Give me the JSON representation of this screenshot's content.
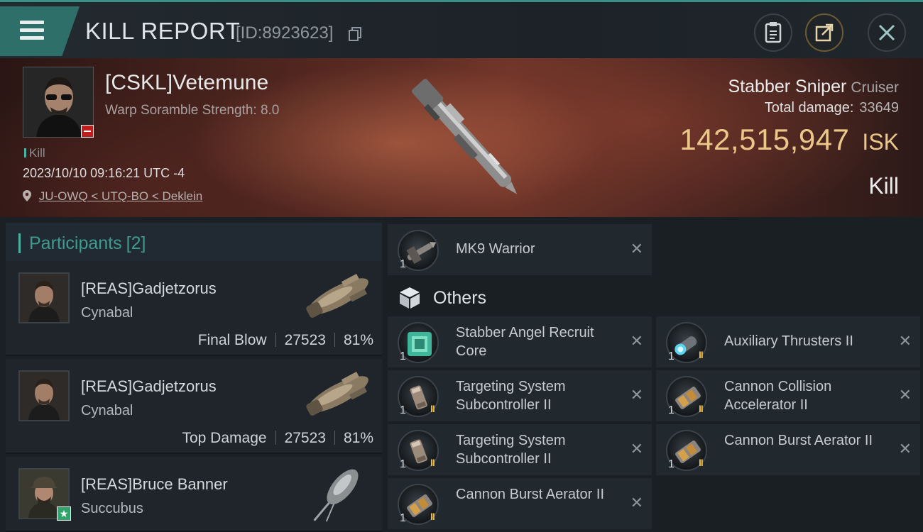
{
  "header": {
    "title": "KILL REPORT",
    "id_text": "[ID:8923623]"
  },
  "victim": {
    "name": "[CSKL]Vetemune",
    "subtitle": "Warp Soramble Strength: 8.0",
    "tag": "Kill",
    "timestamp": "2023/10/10 09:16:21 UTC -4",
    "location": "JU-OWQ < UTQ-BO < Deklein",
    "ship_name": "Stabber Sniper",
    "ship_class": "Cruiser",
    "total_damage_label": "Total damage:",
    "total_damage": "33649",
    "isk_value": "142,515,947",
    "isk_currency": "ISK",
    "result": "Kill"
  },
  "participants": {
    "label": "Participants",
    "count": "[2]",
    "rows": [
      {
        "name": "[REAS]Gadjetzorus",
        "ship": "Cynabal",
        "stat_label": "Final Blow",
        "damage": "27523",
        "percent": "81%"
      },
      {
        "name": "[REAS]Gadjetzorus",
        "ship": "Cynabal",
        "stat_label": "Top Damage",
        "damage": "27523",
        "percent": "81%"
      },
      {
        "name": "[REAS]Bruce Banner",
        "ship": "Succubus"
      }
    ]
  },
  "drone": {
    "qty": "1",
    "name": "MK9  Warrior"
  },
  "others_label": "Others",
  "items": [
    {
      "qty": "1",
      "name": "Stabber Angel Recruit Core",
      "tech": ""
    },
    {
      "qty": "1",
      "name": "Auxiliary Thrusters II",
      "tech": "II"
    },
    {
      "qty": "1",
      "name": "Targeting System Subcontroller II",
      "tech": "II"
    },
    {
      "qty": "1",
      "name": "Cannon Collision Accelerator II",
      "tech": "II"
    },
    {
      "qty": "1",
      "name": "Targeting System Subcontroller II",
      "tech": "II"
    },
    {
      "qty": "1",
      "name": "Cannon Burst Aerator II",
      "tech": "II"
    },
    {
      "qty": "1",
      "name": "Cannon Burst Aerator II",
      "tech": "II"
    }
  ],
  "icons": {
    "menu": "hamburger-icon",
    "copy": "copy-icon",
    "clipboard": "clipboard-icon",
    "share": "share-icon",
    "close": "close-icon",
    "location": "location-pin-icon",
    "others": "cube-icon",
    "remove": "x-icon"
  },
  "colors": {
    "accent": "#3f9a90",
    "isk_gold": "#ecc78a",
    "tech_gold": "#e5b94a",
    "victim_badge": "#c01d1d"
  }
}
